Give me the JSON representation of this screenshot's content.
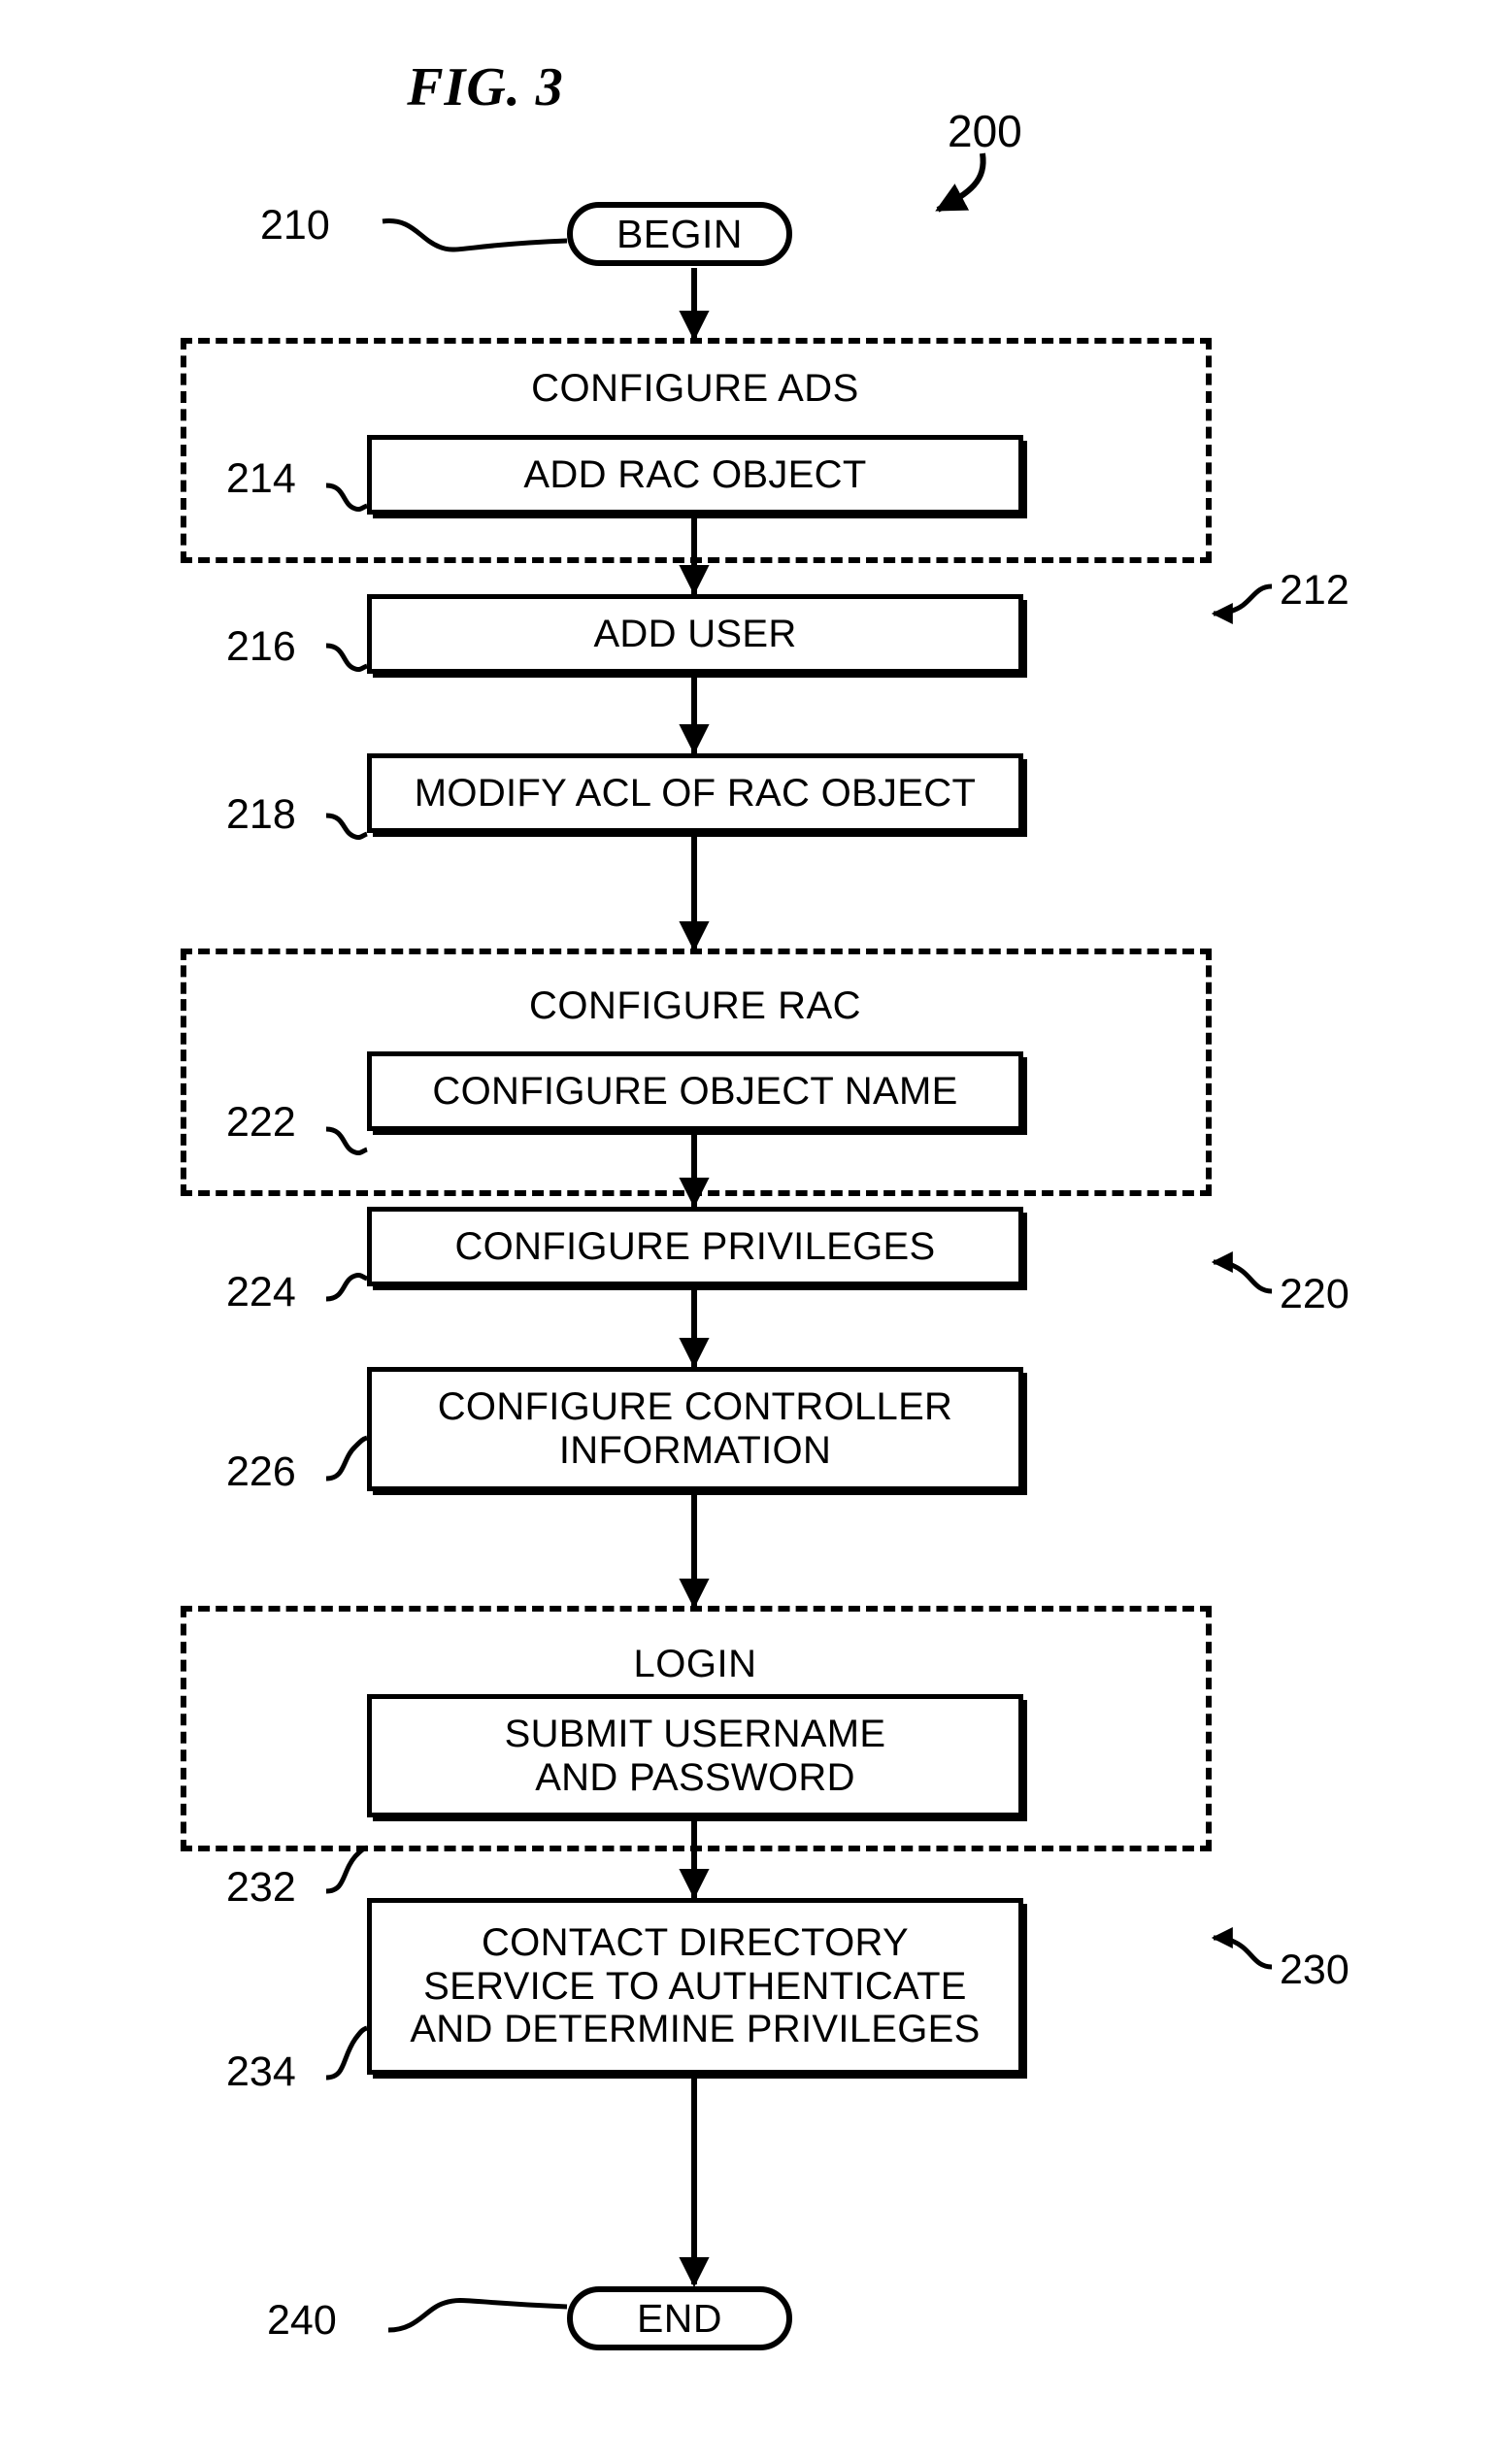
{
  "figure": {
    "title": "FIG. 3",
    "overall_ref": "200"
  },
  "terminators": {
    "begin": {
      "label": "BEGIN",
      "ref": "210"
    },
    "end": {
      "label": "END",
      "ref": "240"
    }
  },
  "groups": [
    {
      "title": "CONFIGURE ADS",
      "ref": "212",
      "steps": [
        {
          "ref": "214",
          "lines": [
            "ADD RAC OBJECT"
          ]
        },
        {
          "ref": "216",
          "lines": [
            "ADD USER"
          ]
        },
        {
          "ref": "218",
          "lines": [
            "MODIFY ACL OF RAC OBJECT"
          ]
        }
      ]
    },
    {
      "title": "CONFIGURE RAC",
      "ref": "220",
      "steps": [
        {
          "ref": "222",
          "lines": [
            "CONFIGURE OBJECT NAME"
          ]
        },
        {
          "ref": "224",
          "lines": [
            "CONFIGURE PRIVILEGES"
          ]
        },
        {
          "ref": "226",
          "lines": [
            "CONFIGURE CONTROLLER",
            "INFORMATION"
          ]
        }
      ]
    },
    {
      "title": "LOGIN",
      "ref": "230",
      "steps": [
        {
          "ref": "232",
          "lines": [
            "SUBMIT USERNAME",
            "AND PASSWORD"
          ]
        },
        {
          "ref": "234",
          "lines": [
            "CONTACT DIRECTORY",
            "SERVICE TO AUTHENTICATE",
            "AND DETERMINE PRIVILEGES"
          ]
        }
      ]
    }
  ],
  "colors": {
    "ink": "#000000",
    "paper": "#ffffff"
  }
}
